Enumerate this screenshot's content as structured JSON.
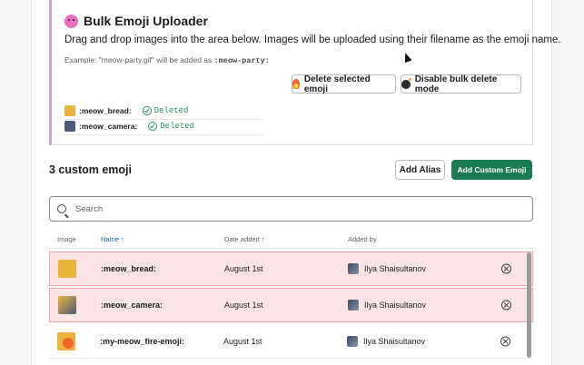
{
  "uploader": {
    "title": "Bulk Emoji Uploader",
    "description": "Drag and drop images into the area below. Images will be uploaded using their filename as the emoji name.",
    "example_prefix": "Example: \"meow-party.gif\" will be added as",
    "example_code": ":meow-party:",
    "delete_button": "Delete selected emoji",
    "disable_button": "Disable bulk delete mode",
    "items": [
      {
        "name": ":meow_bread:",
        "status": "Deleted"
      },
      {
        "name": ":meow_camera:",
        "status": "Deleted"
      }
    ]
  },
  "section": {
    "title": "3 custom emoji",
    "add_alias": "Add Alias",
    "add_custom": "Add Custom Emoji"
  },
  "search": {
    "placeholder": "Search"
  },
  "table": {
    "headers": {
      "image": "Image",
      "name": "Name ↑",
      "date": "Date added ↑",
      "added_by": "Added by"
    },
    "rows": [
      {
        "name": ":meow_bread:",
        "date": "August 1st",
        "user": "Ilya Shaisultanov",
        "deleted": true
      },
      {
        "name": ":meow_camera:",
        "date": "August 1st",
        "user": "Ilya Shaisultanov",
        "deleted": true
      },
      {
        "name": ":my-meow_fire-emoji:",
        "date": "August 1st",
        "user": "Ilya Shaisultanov",
        "deleted": false
      }
    ]
  },
  "colors": {
    "accent_green": "#1a7a52",
    "delete_highlight": "#fbe4e6",
    "link_blue": "#1264a3"
  }
}
